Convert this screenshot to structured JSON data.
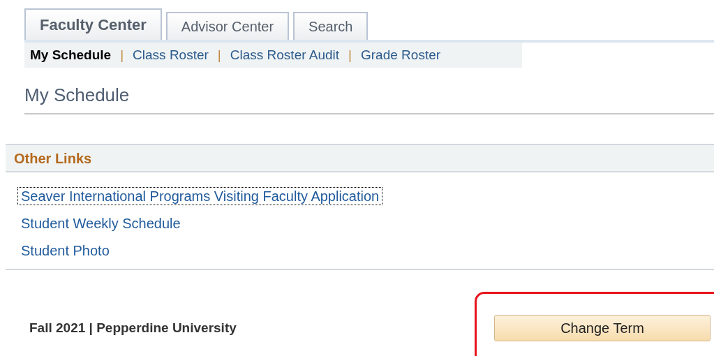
{
  "tabs": [
    {
      "label": "Faculty Center",
      "selected": true
    },
    {
      "label": "Advisor Center",
      "selected": false
    },
    {
      "label": "Search",
      "selected": false
    }
  ],
  "subnav": [
    {
      "label": "My Schedule",
      "selected": true
    },
    {
      "label": "Class Roster",
      "selected": false
    },
    {
      "label": "Class Roster Audit",
      "selected": false
    },
    {
      "label": "Grade Roster",
      "selected": false
    }
  ],
  "subnav_separator": "|",
  "page_title": "My Schedule",
  "other_links": {
    "title": "Other Links",
    "links": [
      {
        "label": "Seaver International Programs Visiting Faculty Application",
        "focused": true
      },
      {
        "label": "Student Weekly Schedule",
        "focused": false
      },
      {
        "label": "Student Photo",
        "focused": false
      }
    ]
  },
  "footer": {
    "term": "Fall 2021 | Pepperdine University",
    "button": "Change Term",
    "highlighted": true
  }
}
